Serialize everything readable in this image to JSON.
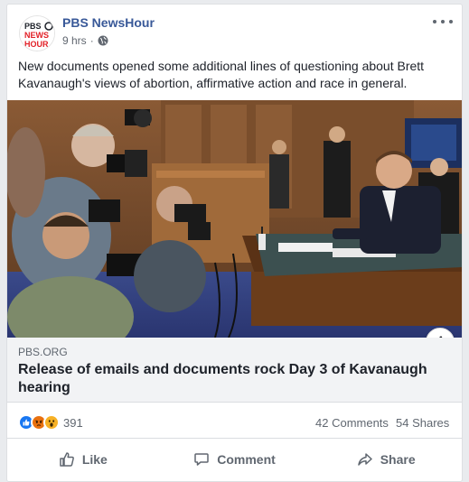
{
  "post": {
    "page_name": "PBS NewsHour",
    "time": "9 hrs",
    "separator": "·",
    "avatar_logo": [
      "PBS",
      "NEWS",
      "HOUR"
    ],
    "text": "New documents opened some additional lines of questioning about Brett Kavanaugh's views of abortion, affirmative action and race in general."
  },
  "link": {
    "domain": "PBS.ORG",
    "title": "Release of emails and documents rock Day 3 of Kavanaugh hearing",
    "info_icon": "info-icon"
  },
  "stats": {
    "reaction_icons": [
      "like",
      "angry",
      "wow"
    ],
    "reaction_count": "391",
    "comments": "42 Comments",
    "shares": "54 Shares"
  },
  "actions": {
    "like": "Like",
    "comment": "Comment",
    "share": "Share"
  },
  "colors": {
    "link_blue": "#385898",
    "pbs_red": "#e21f26",
    "like_blue": "#1877f2",
    "angry_orange": "#e9710f",
    "wow_yellow": "#f7b125"
  }
}
